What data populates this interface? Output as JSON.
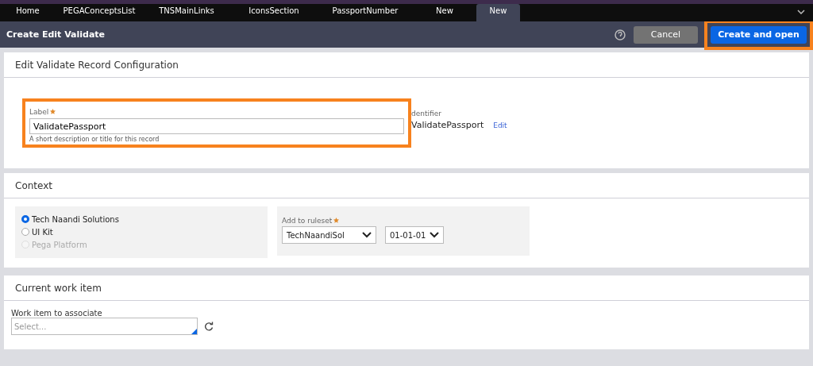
{
  "tabs": [
    {
      "label": "Home",
      "selected": false
    },
    {
      "label": "PEGAConceptsList",
      "selected": false
    },
    {
      "label": "TNSMainLinks",
      "selected": false
    },
    {
      "label": "IconsSection",
      "selected": false
    },
    {
      "label": "PassportNumber",
      "selected": false
    },
    {
      "label": "New",
      "selected": false
    },
    {
      "label": "New",
      "selected": true
    }
  ],
  "header": {
    "title": "Create Edit Validate",
    "cancel": "Cancel",
    "create": {
      "label": "Create and open",
      "highlighted": true
    }
  },
  "config": {
    "title": "Edit Validate Record Configuration",
    "label_field": {
      "label": "Label",
      "required": true,
      "value": "ValidatePassport",
      "hint": "A short description or title for this record",
      "highlighted": true
    },
    "identifier": {
      "label": "dentifier",
      "value": "ValidatePassport",
      "edit": "Edit"
    }
  },
  "context": {
    "title": "Context",
    "options": [
      {
        "label": "Tech Naandi Solutions",
        "selected": true,
        "disabled": false
      },
      {
        "label": "UI Kit",
        "selected": false,
        "disabled": false
      },
      {
        "label": "Pega Platform",
        "selected": false,
        "disabled": true
      }
    ],
    "ruleset": {
      "label": "Add to ruleset",
      "required": true,
      "value": "TechNaandiSol",
      "version": "01-01-01"
    }
  },
  "work": {
    "title": "Current work item",
    "label": "Work item to associate",
    "placeholder": "Select..."
  }
}
